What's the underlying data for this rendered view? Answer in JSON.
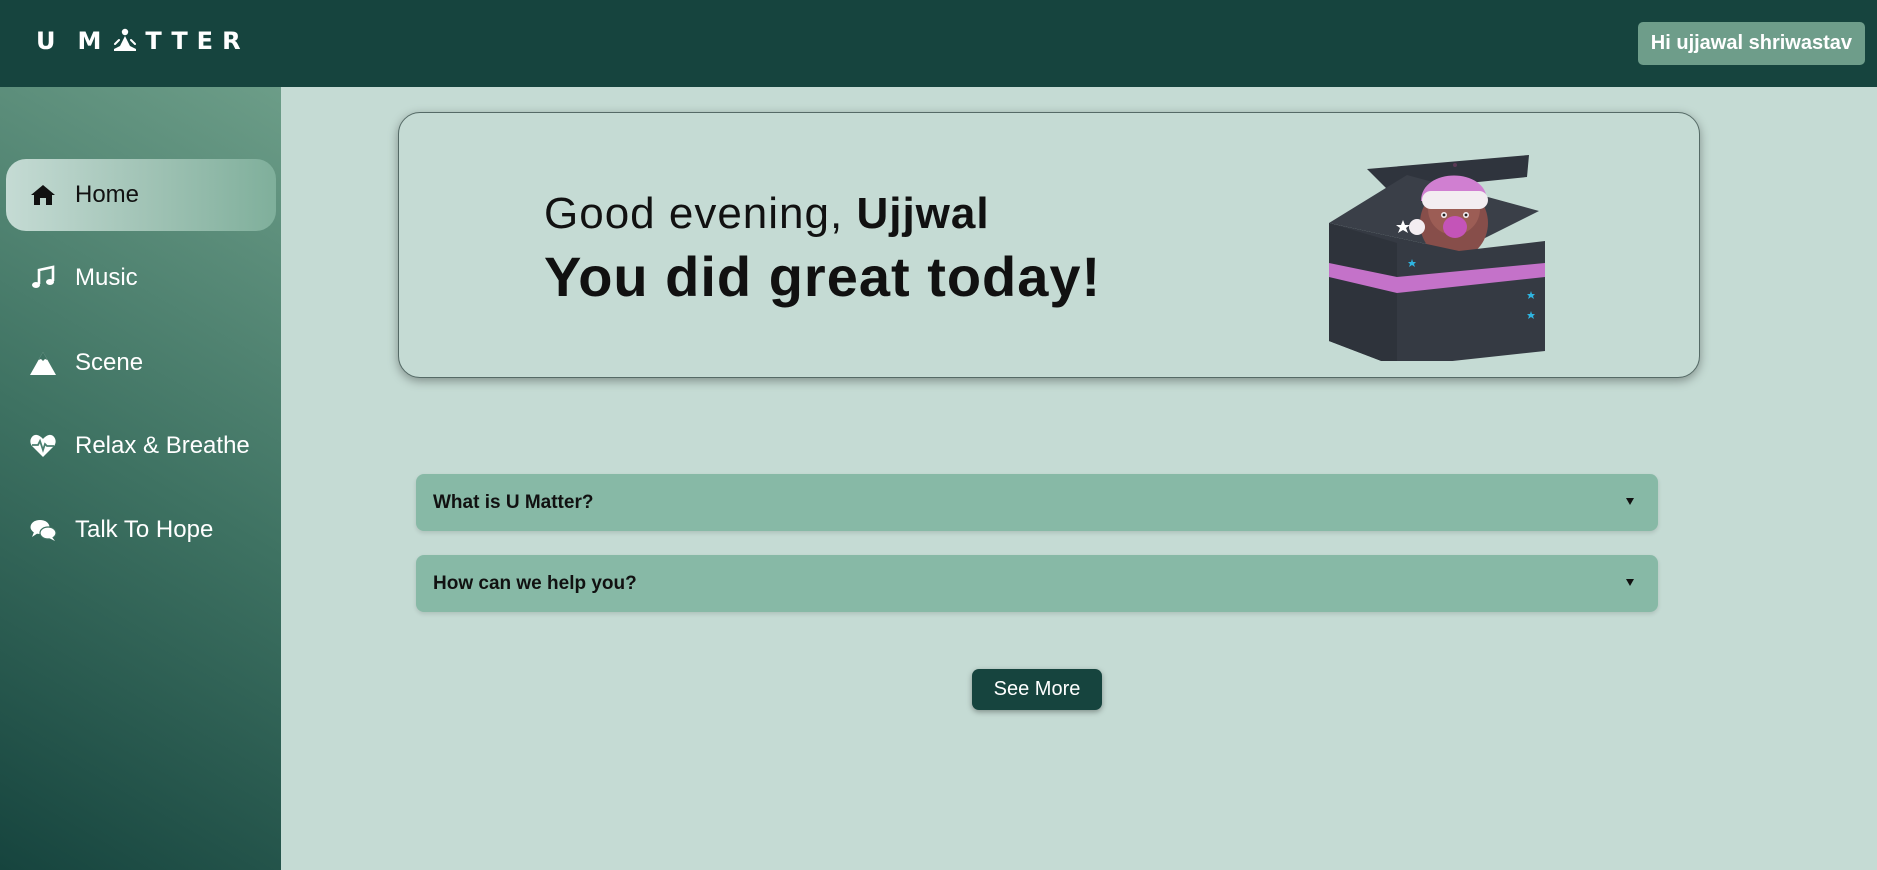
{
  "header": {
    "logo": {
      "part1": "U",
      "part2": "M",
      "part3": "TTER"
    },
    "greeting": "Hi ujjawal shriwastav"
  },
  "sidebar": {
    "items": [
      {
        "label": "Home",
        "icon": "home-icon",
        "active": true
      },
      {
        "label": "Music",
        "icon": "music-note-icon",
        "active": false
      },
      {
        "label": "Scene",
        "icon": "mountain-icon",
        "active": false
      },
      {
        "label": "Relax & Breathe",
        "icon": "heartbeat-icon",
        "active": false
      },
      {
        "label": "Talk To Hope",
        "icon": "chat-bubbles-icon",
        "active": false
      }
    ]
  },
  "hero": {
    "greeting_prefix": "Good evening, ",
    "user_name": "Ujjwal",
    "message": "You did great today!"
  },
  "faq": [
    {
      "question": "What is U Matter?"
    },
    {
      "question": "How can we help you?"
    }
  ],
  "see_more_label": "See More",
  "colors": {
    "header_bg": "#16443e",
    "page_bg": "#c5dbd4",
    "accordion_bg": "#87b9a6",
    "badge_bg": "#6e9d8a",
    "button_bg": "#16443e"
  }
}
